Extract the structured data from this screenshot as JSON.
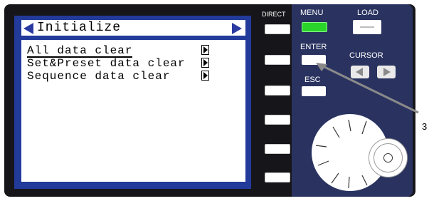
{
  "lcd": {
    "title": "Initialize",
    "items": [
      {
        "label": "All data clear",
        "selected": true
      },
      {
        "label": "Set&Preset data clear",
        "selected": false
      },
      {
        "label": "Sequence data clear",
        "selected": false
      }
    ]
  },
  "panel_labels": {
    "direct": "DIRECT",
    "menu": "MENU",
    "load": "LOAD",
    "enter": "ENTER",
    "cursor": "CURSOR",
    "esc": "ESC"
  },
  "callout": {
    "number": "3"
  },
  "colors": {
    "panel": "#16161a",
    "right_panel": "#2a3360",
    "lcd_frame": "#223a9a",
    "menu_led": "#2ad42a",
    "callout_line": "#8a8a8a"
  }
}
